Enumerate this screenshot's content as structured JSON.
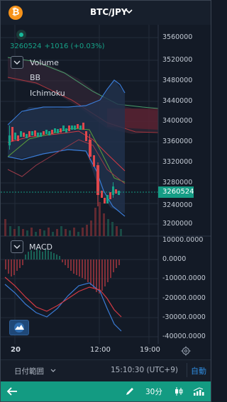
{
  "header": {
    "coin_icon": "bitcoin-icon",
    "coin_symbol": "₿",
    "pair": "BTC/JPY"
  },
  "ticker": {
    "price": "3260524",
    "change": "+1016 (+0.03%)"
  },
  "indicators": {
    "items": [
      "Volume",
      "BB",
      "Ichimoku"
    ]
  },
  "price_axis": {
    "labels": [
      "3560000",
      "3520000",
      "3480000",
      "3440000",
      "3400000",
      "3360000",
      "3320000",
      "3280000",
      "3240000",
      "3200000"
    ],
    "current_price_tag": "3260524"
  },
  "macd": {
    "label": "MACD",
    "axis_labels": [
      "10000.0000",
      "0.0000",
      "-10000.0000",
      "-20000.0000",
      "-30000.0000",
      "-40000.0000"
    ]
  },
  "time_axis": {
    "labels": [
      "20",
      "12:00",
      "19:00"
    ]
  },
  "bottom_bar": {
    "range_label": "日付範囲",
    "time": "15:10:30 (UTC+9)",
    "auto": "自動"
  },
  "footer": {
    "interval": "30分",
    "icons": [
      "back-arrow-icon",
      "draw-pen-icon",
      "candlestick-icon",
      "indicator-chart-icon"
    ]
  },
  "colors": {
    "up": "#16a388",
    "down": "#e0474c",
    "accent": "#139b82",
    "bb_band": "#3a7bd5",
    "ma_red": "#d43a44"
  }
}
